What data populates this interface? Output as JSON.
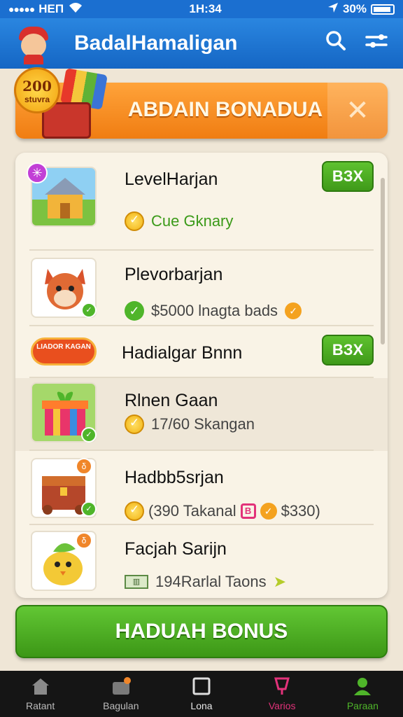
{
  "status": {
    "carrier": "HEΠ",
    "time": "1Η:34",
    "battery": "30%"
  },
  "header": {
    "title": "BadalHamaligan"
  },
  "promo": {
    "title": "ABDAIN BONADUA",
    "badge_number": "200",
    "badge_text": "stuvra"
  },
  "list": {
    "rows": [
      {
        "name": "LevelHarjan",
        "subtitle": "Cue Gknary",
        "button": "BЗX"
      },
      {
        "name": "Plevorbarjan",
        "subtitle": "$5000 lnagta  bads"
      },
      {
        "name": "Hadialgar Bnnn",
        "sticker": "LIADOR KAGAN",
        "button": "BЗX"
      },
      {
        "name": "Rlnen Gaan",
        "subtitle": "17/60 Skangan"
      },
      {
        "name": "Hadbb5srjan",
        "subtitle": "(390 Takanal",
        "extra": "$330)"
      },
      {
        "name": "Facjah Sarijn",
        "subtitle": "194Rarlal Taons"
      }
    ]
  },
  "cta": {
    "label": "HADUAH BONUS"
  },
  "nav": {
    "tabs": [
      {
        "label": "Ratant",
        "color": "#c8c8c8"
      },
      {
        "label": "Bagulan",
        "color": "#c8c8c8"
      },
      {
        "label": "Lona",
        "color": "#e8e8e8"
      },
      {
        "label": "Varios",
        "color": "#e2327a"
      },
      {
        "label": "Paraan",
        "color": "#4fb52a"
      }
    ]
  }
}
